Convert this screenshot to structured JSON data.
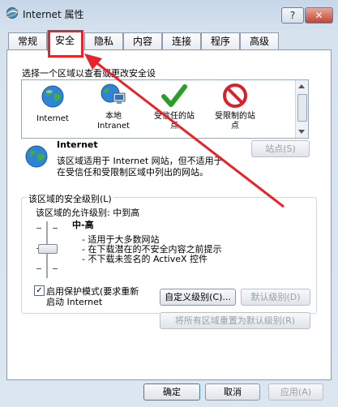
{
  "window": {
    "title": "Internet 属性",
    "help_label": "?",
    "close_label": "✕"
  },
  "tabs": [
    {
      "label": "常规"
    },
    {
      "label": "安全",
      "active": true
    },
    {
      "label": "隐私"
    },
    {
      "label": "内容"
    },
    {
      "label": "连接"
    },
    {
      "label": "程序"
    },
    {
      "label": "高级"
    }
  ],
  "zones_prompt": "选择一个区域以查看或更改安全设",
  "zones": [
    {
      "label": "Internet",
      "icon": "globe-icon"
    },
    {
      "label": "本地 Intranet",
      "line1": "本地",
      "line2": "Intranet",
      "icon": "intranet-icon"
    },
    {
      "label": "受信任的站点",
      "line1": "受信任的站",
      "line2": "点",
      "icon": "checkmark-icon"
    },
    {
      "label": "受限制的站点",
      "line1": "受限制的站",
      "line2": "点",
      "icon": "restricted-icon"
    }
  ],
  "selected_zone": {
    "name": "Internet",
    "description_line1": "该区域适用于 Internet 网站，但不适用于",
    "description_line2": "在受信任和受限制区域中列出的网站。",
    "sites_button": "站点(S)"
  },
  "security_level": {
    "group_title": "该区域的安全级别(L)",
    "allowed_levels": "该区域的允许级别: 中到高",
    "current_level": "中-高",
    "bullets": [
      "- 适用于大多数网站",
      "- 在下载潜在的不安全内容之前提示",
      "- 不下载未签名的 ActiveX 控件"
    ]
  },
  "protected_mode": {
    "checked": true,
    "line1": "启用保护模式(要求重新",
    "line2": "启动 Internet"
  },
  "buttons": {
    "custom_level": "自定义级别(C)...",
    "default_level": "默认级别(D)",
    "reset_all": "将所有区域重置为默认级别(R)",
    "ok": "确定",
    "cancel": "取消",
    "apply": "应用(A)"
  },
  "colors": {
    "annotation": "#e8242a"
  }
}
